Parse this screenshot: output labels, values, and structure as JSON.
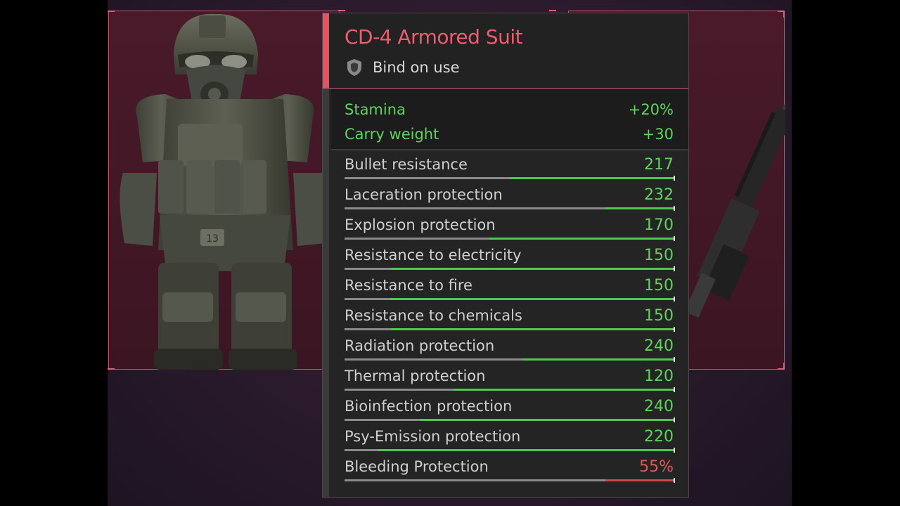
{
  "item": {
    "title": "CD-4 Armored Suit",
    "bind_text": "Bind on use",
    "bind_icon": "shield-icon"
  },
  "bonuses": [
    {
      "label": "Stamina",
      "value": "+20%"
    },
    {
      "label": "Carry weight",
      "value": "+30"
    }
  ],
  "stats": [
    {
      "label": "Bullet resistance",
      "value": "217",
      "fill": 0.5,
      "color": "green"
    },
    {
      "label": "Laceration protection",
      "value": "232",
      "fill": 0.21,
      "color": "green"
    },
    {
      "label": "Explosion protection",
      "value": "170",
      "fill": 0.56,
      "color": "green"
    },
    {
      "label": "Resistance to electricity",
      "value": "150",
      "fill": 0.86,
      "color": "green"
    },
    {
      "label": "Resistance to fire",
      "value": "150",
      "fill": 0.86,
      "color": "green"
    },
    {
      "label": "Resistance to chemicals",
      "value": "150",
      "fill": 0.86,
      "color": "green"
    },
    {
      "label": "Radiation protection",
      "value": "240",
      "fill": 0.46,
      "color": "green"
    },
    {
      "label": "Thermal protection",
      "value": "120",
      "fill": 0.67,
      "color": "green"
    },
    {
      "label": "Bioinfection protection",
      "value": "240",
      "fill": 0.77,
      "color": "green"
    },
    {
      "label": "Psy-Emission protection",
      "value": "220",
      "fill": 0.9,
      "color": "green"
    },
    {
      "label": "Bleeding Protection",
      "value": "55%",
      "fill": 0.21,
      "color": "red"
    }
  ],
  "colors": {
    "accent": "#e35265",
    "bonus_text": "#5fd25f",
    "bar_green": "#4ec94e",
    "bar_red": "#d64545",
    "background": "#2a1a2c"
  }
}
